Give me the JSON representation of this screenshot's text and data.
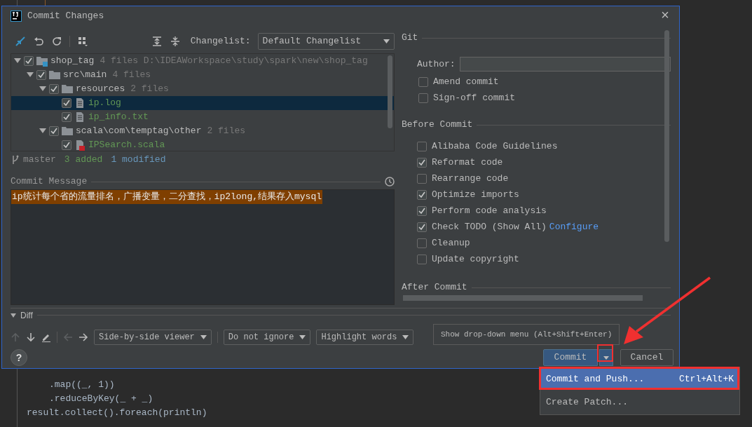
{
  "editor": {
    "bottom_lines": [
      ".map((_, 1))",
      ".reduceByKey(_ + _)",
      "result.collect().foreach(println)"
    ]
  },
  "window": {
    "title": "Commit Changes",
    "close": "×"
  },
  "toolbar": {
    "changelist_label": "Changelist:",
    "changelist_value": "Default Changelist"
  },
  "tree": [
    {
      "name": "shop_tag",
      "info": "4 files  D:\\IDEAWorkspace\\study\\spark\\new\\shop_tag",
      "kind": "module",
      "checked": true,
      "expanded": true,
      "selected": false,
      "children": [
        {
          "name": "src\\main",
          "info": "4 files",
          "kind": "folder",
          "checked": true,
          "expanded": true,
          "selected": false,
          "children": [
            {
              "name": "resources",
              "info": "2 files",
              "kind": "folder",
              "checked": true,
              "expanded": true,
              "selected": false,
              "children": [
                {
                  "name": "ip.log",
                  "kind": "file",
                  "checked": true,
                  "selected": true
                },
                {
                  "name": "ip_info.txt",
                  "kind": "file",
                  "checked": true,
                  "selected": false
                }
              ]
            },
            {
              "name": "scala\\com\\temptag\\other",
              "info": "2 files",
              "kind": "folder",
              "checked": true,
              "expanded": true,
              "selected": false,
              "children": [
                {
                  "name": "IPSearch.scala",
                  "kind": "scala",
                  "checked": true,
                  "selected": false
                }
              ]
            }
          ]
        }
      ]
    }
  ],
  "status": {
    "branch": "master",
    "added": "3 added",
    "modified": "1 modified"
  },
  "commit_message": {
    "label": "Commit Message",
    "text": "ip统计每个省的流量排名，广播变量，二分查找，ip2long,结果存入mysql"
  },
  "git": {
    "title": "Git",
    "author_label": "Author:",
    "options": [
      {
        "label": "Amend commit",
        "checked": false
      },
      {
        "label": "Sign-off commit",
        "checked": false
      }
    ]
  },
  "before_commit": {
    "title": "Before Commit",
    "options": [
      {
        "label": "Alibaba Code Guidelines",
        "checked": false
      },
      {
        "label": "Reformat code",
        "checked": true
      },
      {
        "label": "Rearrange code",
        "checked": false
      },
      {
        "label": "Optimize imports",
        "checked": true
      },
      {
        "label": "Perform code analysis",
        "checked": true
      },
      {
        "label": "Check TODO (Show All)",
        "checked": true,
        "link": "Configure"
      },
      {
        "label": "Cleanup",
        "checked": false
      },
      {
        "label": "Update copyright",
        "checked": false
      }
    ]
  },
  "after_commit": {
    "title": "After Commit"
  },
  "diff": {
    "title": "Diff",
    "expanded": true,
    "viewer": "Side-by-side viewer",
    "ignore": "Do not ignore",
    "highlight": "Highlight words"
  },
  "buttons": {
    "help": "?",
    "commit": "Commit",
    "cancel": "Cancel"
  },
  "tooltip": "Show drop-down menu (Alt+Shift+Enter)",
  "menu": [
    {
      "label": "Commit and Push...",
      "shortcut": "Ctrl+Alt+K",
      "selected": true
    },
    {
      "label": "Create Patch...",
      "selected": false
    }
  ]
}
